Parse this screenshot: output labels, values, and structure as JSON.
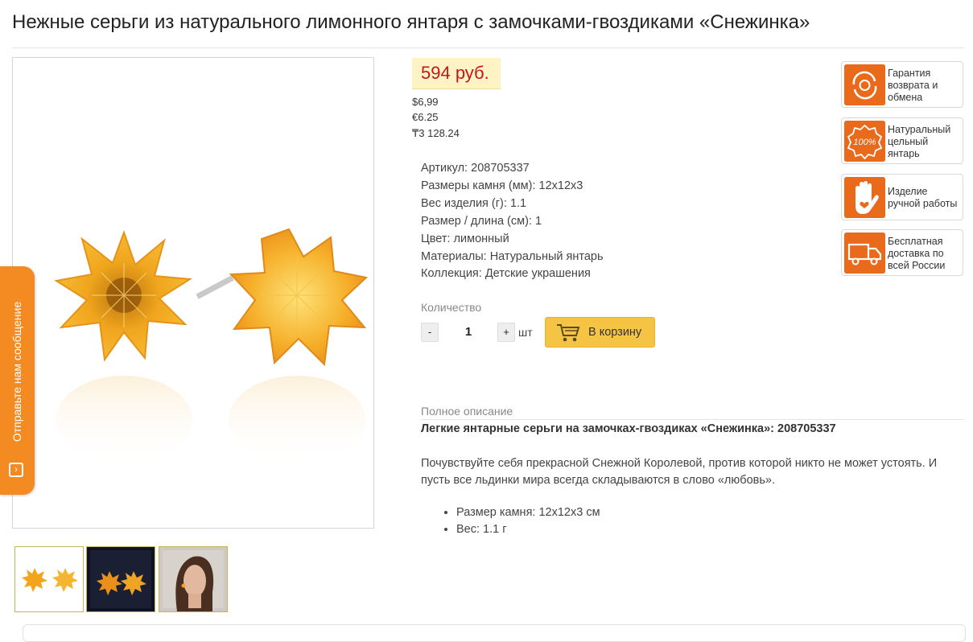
{
  "product": {
    "title": "Нежные серьги из натурального лимонного янтаря с замочками-гвоздиками «Снежинка»"
  },
  "price": {
    "main": "594 руб.",
    "usd": "$6,99",
    "eur": "€6.25",
    "kzt": "₸3 128.24"
  },
  "specs": [
    {
      "label": "Артикул:",
      "value": "208705337"
    },
    {
      "label": "Размеры камня (мм):",
      "value": "12x12x3"
    },
    {
      "label": "Вес изделия (г):",
      "value": "1.1"
    },
    {
      "label": "Размер / длина (см):",
      "value": "1"
    },
    {
      "label": "Цвет:",
      "value": "лимонный"
    },
    {
      "label": "Материалы:",
      "value": "Натуральный янтарь"
    },
    {
      "label": "Коллекция:",
      "value": "Детские украшения"
    }
  ],
  "quantity": {
    "label": "Количество",
    "minus": "-",
    "value": "1",
    "plus": "+",
    "unit": "шт"
  },
  "cart": {
    "label": "В корзину"
  },
  "badges": [
    {
      "text": "Гарантия возврата и обмена",
      "icon": "return-guarantee-icon"
    },
    {
      "text": "Натуральный цельный янтарь",
      "icon": "natural-amber-100-icon"
    },
    {
      "text": "Изделие ручной работы",
      "icon": "handmade-hand-icon"
    },
    {
      "text": "Бесплатная доставка по всей России",
      "icon": "delivery-truck-icon"
    }
  ],
  "feedback": {
    "label": "Отправьте нам сообщение"
  },
  "description": {
    "label": "Полное описание",
    "heading": "Легкие янтарные серьги на замочках-гвоздиках «Снежинка»: 208705337",
    "text": "Почувствуйте себя прекрасной Снежной Королевой, против которой никто не может устоять. И пусть все льдинки мира всегда складываются в слово «любовь».",
    "bullets": [
      "Размер камня: 12x12x3 см",
      "Вес: 1.1 г"
    ]
  },
  "badge_icon_text": "100%",
  "colors": {
    "price_red": "#c5161d",
    "price_bg": "#fdf3c4",
    "accent_orange": "#f38a22",
    "cart_yellow": "#f6c445",
    "amber": "#f2a51c"
  }
}
